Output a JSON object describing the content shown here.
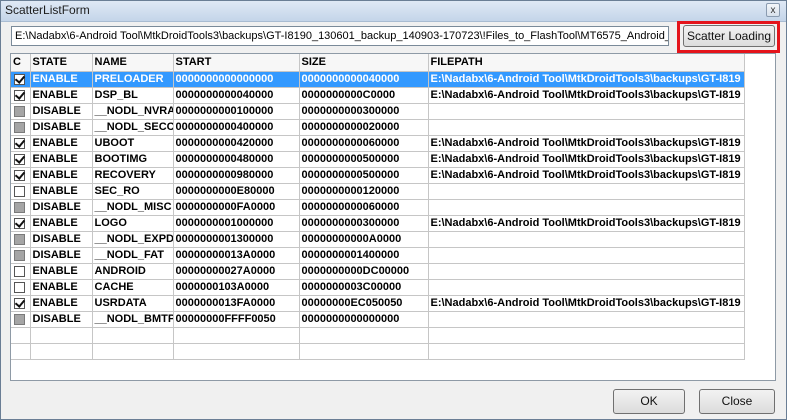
{
  "window": {
    "title": "ScatterListForm",
    "close_glyph": "x"
  },
  "path_input": {
    "value": "E:\\Nadabx\\6-Android Tool\\MtkDroidTools3\\backups\\GT-I8190_130601_backup_140903-170723\\!Files_to_FlashTool\\MT6575_Android_"
  },
  "buttons": {
    "scatter": "Scatter Loading",
    "ok": "OK",
    "close": "Close"
  },
  "columns": {
    "c": "C",
    "state": "STATE",
    "name": "NAME",
    "start": "START",
    "size": "SIZE",
    "filepath": "FILEPATH"
  },
  "rows": [
    {
      "checked": true,
      "disabled": false,
      "state": "ENABLE",
      "name": "PRELOADER",
      "start": "0000000000000000",
      "size": "0000000000040000",
      "filepath": "E:\\Nadabx\\6-Android Tool\\MtkDroidTools3\\backups\\GT-I819",
      "selected": true
    },
    {
      "checked": true,
      "disabled": false,
      "state": "ENABLE",
      "name": "DSP_BL",
      "start": "0000000000040000",
      "size": "0000000000C0000",
      "filepath": "E:\\Nadabx\\6-Android Tool\\MtkDroidTools3\\backups\\GT-I819"
    },
    {
      "checked": false,
      "disabled": true,
      "state": "DISABLE",
      "name": "__NODL_NVRAM",
      "start": "0000000000100000",
      "size": "0000000000300000",
      "filepath": ""
    },
    {
      "checked": false,
      "disabled": true,
      "state": "DISABLE",
      "name": "__NODL_SECCFG",
      "start": "0000000000400000",
      "size": "0000000000020000",
      "filepath": ""
    },
    {
      "checked": true,
      "disabled": false,
      "state": "ENABLE",
      "name": "UBOOT",
      "start": "0000000000420000",
      "size": "0000000000060000",
      "filepath": "E:\\Nadabx\\6-Android Tool\\MtkDroidTools3\\backups\\GT-I819"
    },
    {
      "checked": true,
      "disabled": false,
      "state": "ENABLE",
      "name": "BOOTIMG",
      "start": "0000000000480000",
      "size": "0000000000500000",
      "filepath": "E:\\Nadabx\\6-Android Tool\\MtkDroidTools3\\backups\\GT-I819"
    },
    {
      "checked": true,
      "disabled": false,
      "state": "ENABLE",
      "name": "RECOVERY",
      "start": "0000000000980000",
      "size": "0000000000500000",
      "filepath": "E:\\Nadabx\\6-Android Tool\\MtkDroidTools3\\backups\\GT-I819"
    },
    {
      "checked": false,
      "disabled": false,
      "state": "ENABLE",
      "name": "SEC_RO",
      "start": "0000000000E80000",
      "size": "0000000000120000",
      "filepath": ""
    },
    {
      "checked": false,
      "disabled": true,
      "state": "DISABLE",
      "name": "__NODL_MISC",
      "start": "0000000000FA0000",
      "size": "0000000000060000",
      "filepath": ""
    },
    {
      "checked": true,
      "disabled": false,
      "state": "ENABLE",
      "name": "LOGO",
      "start": "0000000001000000",
      "size": "0000000000300000",
      "filepath": "E:\\Nadabx\\6-Android Tool\\MtkDroidTools3\\backups\\GT-I819"
    },
    {
      "checked": false,
      "disabled": true,
      "state": "DISABLE",
      "name": "__NODL_EXPDB",
      "start": "0000000001300000",
      "size": "00000000000A0000",
      "filepath": ""
    },
    {
      "checked": false,
      "disabled": true,
      "state": "DISABLE",
      "name": "__NODL_FAT",
      "start": "00000000013A0000",
      "size": "0000000001400000",
      "filepath": ""
    },
    {
      "checked": false,
      "disabled": false,
      "state": "ENABLE",
      "name": "ANDROID",
      "start": "00000000027A0000",
      "size": "0000000000DC00000",
      "filepath": ""
    },
    {
      "checked": false,
      "disabled": false,
      "state": "ENABLE",
      "name": "CACHE",
      "start": "0000000103A0000",
      "size": "0000000003C00000",
      "filepath": ""
    },
    {
      "checked": true,
      "disabled": false,
      "state": "ENABLE",
      "name": "USRDATA",
      "start": "0000000013FA0000",
      "size": "00000000EC050050",
      "filepath": "E:\\Nadabx\\6-Android Tool\\MtkDroidTools3\\backups\\GT-I819"
    },
    {
      "checked": false,
      "disabled": true,
      "state": "DISABLE",
      "name": "__NODL_BMTPOOL",
      "start": "00000000FFFF0050",
      "size": "0000000000000000",
      "filepath": ""
    }
  ]
}
